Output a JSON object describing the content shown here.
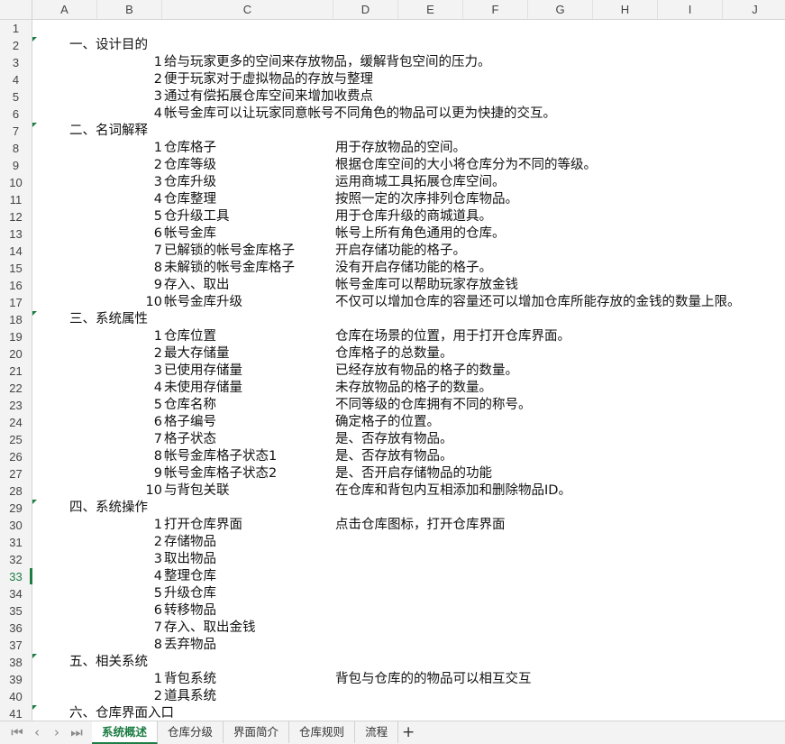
{
  "columns": [
    "A",
    "B",
    "C",
    "D",
    "E",
    "F",
    "G",
    "H",
    "I",
    "J"
  ],
  "row_numbers": [
    "1",
    "2",
    "3",
    "4",
    "5",
    "6",
    "7",
    "8",
    "9",
    "10",
    "11",
    "12",
    "13",
    "14",
    "15",
    "16",
    "17",
    "18",
    "19",
    "20",
    "21",
    "22",
    "23",
    "24",
    "25",
    "26",
    "27",
    "28",
    "29",
    "30",
    "31",
    "32",
    "33",
    "34",
    "35",
    "36",
    "37",
    "38",
    "39",
    "40",
    "41"
  ],
  "active_row": "33",
  "rows": [
    {
      "n": "1"
    },
    {
      "n": "2",
      "sec": "一、设计目的"
    },
    {
      "n": "3",
      "num": "1",
      "item": "给与玩家更多的空间来存放物品，缓解背包空间的压力。"
    },
    {
      "n": "4",
      "num": "2",
      "item": "便于玩家对于虚拟物品的存放与整理"
    },
    {
      "n": "5",
      "num": "3",
      "item": "通过有偿拓展仓库空间来增加收费点"
    },
    {
      "n": "6",
      "num": "4",
      "item": "帐号金库可以让玩家同意帐号不同角色的物品可以更为快捷的交互。"
    },
    {
      "n": "7",
      "sec": "二、名词解释"
    },
    {
      "n": "8",
      "num": "1",
      "item": "仓库格子",
      "desc": "用于存放物品的空间。"
    },
    {
      "n": "9",
      "num": "2",
      "item": "仓库等级",
      "desc": "根据仓库空间的大小将仓库分为不同的等级。"
    },
    {
      "n": "10",
      "num": "3",
      "item": "仓库升级",
      "desc": "运用商城工具拓展仓库空间。"
    },
    {
      "n": "11",
      "num": "4",
      "item": "仓库整理",
      "desc": "按照一定的次序排列仓库物品。"
    },
    {
      "n": "12",
      "num": "5",
      "item": "仓升级工具",
      "desc": "用于仓库升级的商城道具。"
    },
    {
      "n": "13",
      "num": "6",
      "item": "帐号金库",
      "desc": "帐号上所有角色通用的仓库。"
    },
    {
      "n": "14",
      "num": "7",
      "item": "已解锁的帐号金库格子",
      "desc": "开启存储功能的格子。"
    },
    {
      "n": "15",
      "num": "8",
      "item": "未解锁的帐号金库格子",
      "desc": "没有开启存储功能的格子。"
    },
    {
      "n": "16",
      "num": "9",
      "item": "存入、取出",
      "desc": "帐号金库可以帮助玩家存放金钱"
    },
    {
      "n": "17",
      "num": "10",
      "item": "帐号金库升级",
      "desc": "不仅可以增加仓库的容量还可以增加仓库所能存放的金钱的数量上限。"
    },
    {
      "n": "18",
      "sec": "三、系统属性"
    },
    {
      "n": "19",
      "num": "1",
      "item": "仓库位置",
      "desc": "仓库在场景的位置，用于打开仓库界面。"
    },
    {
      "n": "20",
      "num": "2",
      "item": "最大存储量",
      "desc": "仓库格子的总数量。"
    },
    {
      "n": "21",
      "num": "3",
      "item": "已使用存储量",
      "desc": "已经存放有物品的格子的数量。"
    },
    {
      "n": "22",
      "num": "4",
      "item": "未使用存储量",
      "desc": "未存放物品的格子的数量。"
    },
    {
      "n": "23",
      "num": "5",
      "item": "仓库名称",
      "desc": "不同等级的仓库拥有不同的称号。"
    },
    {
      "n": "24",
      "num": "6",
      "item": "格子编号",
      "desc": "确定格子的位置。"
    },
    {
      "n": "25",
      "num": "7",
      "item": "格子状态",
      "desc": "是、否存放有物品。"
    },
    {
      "n": "26",
      "num": "8",
      "item": "帐号金库格子状态1",
      "desc": "是、否存放有物品。"
    },
    {
      "n": "27",
      "num": "9",
      "item": "帐号金库格子状态2",
      "desc": "是、否开启存储物品的功能"
    },
    {
      "n": "28",
      "num": "10",
      "item": "与背包关联",
      "desc": "在仓库和背包内互相添加和删除物品ID。"
    },
    {
      "n": "29",
      "sec": "四、系统操作"
    },
    {
      "n": "30",
      "num": "1",
      "item": "打开仓库界面",
      "desc": "点击仓库图标，打开仓库界面"
    },
    {
      "n": "31",
      "num": "2",
      "item": "存储物品"
    },
    {
      "n": "32",
      "num": "3",
      "item": "取出物品"
    },
    {
      "n": "33",
      "num": "4",
      "item": "整理仓库"
    },
    {
      "n": "34",
      "num": "5",
      "item": "升级仓库"
    },
    {
      "n": "35",
      "num": "6",
      "item": "转移物品"
    },
    {
      "n": "36",
      "num": "7",
      "item": "存入、取出金钱"
    },
    {
      "n": "37",
      "num": "8",
      "item": "丢弃物品"
    },
    {
      "n": "38",
      "sec": "五、相关系统"
    },
    {
      "n": "39",
      "num": "1",
      "item": "背包系统",
      "desc": "背包与仓库的的物品可以相互交互"
    },
    {
      "n": "40",
      "num": "2",
      "item": "道具系统"
    },
    {
      "n": "41",
      "sec": "六、仓库界面入口"
    }
  ],
  "marker_rows": [
    "2",
    "7",
    "18",
    "29",
    "38",
    "41"
  ],
  "tabs": [
    "系统概述",
    "仓库分级",
    "界面简介",
    "仓库规则",
    "流程"
  ],
  "active_tab": "系统概述",
  "add_tab_label": "+",
  "nav_buttons": [
    "|<",
    "<",
    ">",
    ">|"
  ],
  "colors": {
    "accent": "#1e7d45",
    "header_bg": "#f3f3f3",
    "gridline": "#d4d4d4"
  }
}
